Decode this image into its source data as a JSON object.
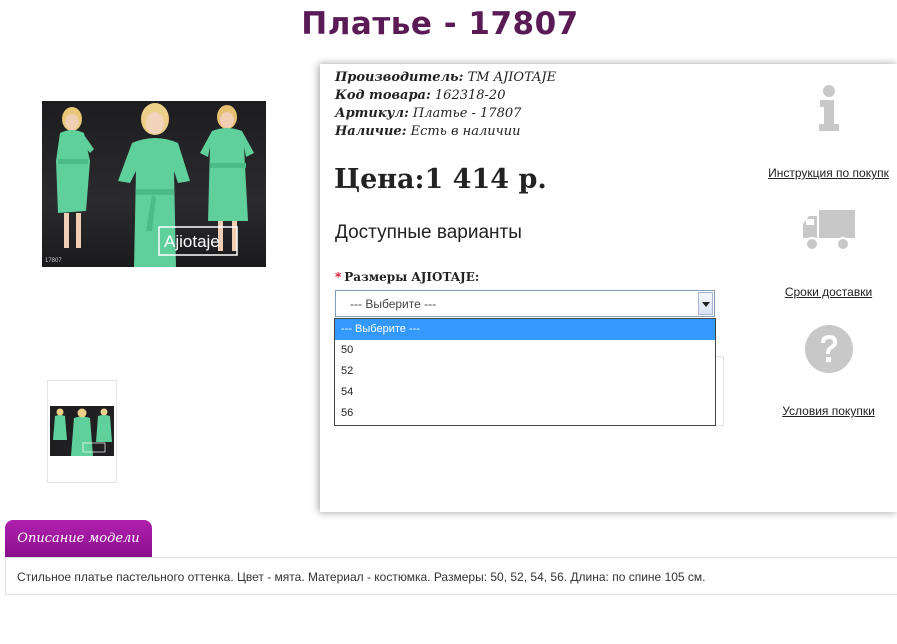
{
  "product": {
    "title": "Платье - 17807",
    "manufacturer_label": "Производитель:",
    "manufacturer_value": "ТМ AJIOTAJE",
    "code_label": "Код товара:",
    "code_value": "162318-20",
    "article_label": "Артикул:",
    "article_value": "Платье - 17807",
    "availability_label": "Наличие:",
    "availability_value": "Есть в наличии",
    "price": "Цена:1 414 р.",
    "photo_brand": "Ajiotaje",
    "photo_code": "17807"
  },
  "options": {
    "title": "Доступные варианты",
    "required_mark": "*",
    "size_label": "Размеры AJIOTAJE:",
    "selected": "--- Выберите ---",
    "items": [
      "--- Выберите ---",
      "50",
      "52",
      "54",
      "56"
    ]
  },
  "sidebar": {
    "instruction": "Инструкция по покупк",
    "delivery": "Сроки доставки",
    "conditions": "Условия покупки"
  },
  "tabs": {
    "description_label": "Описание модели"
  },
  "description": {
    "text": "Стильное платье пастельного оттенка. Цвет - мята. Материал - костюмка. Размеры: 50, 52, 54, 56. Длина: по спине 105 см."
  },
  "colors": {
    "title": "#5a1a55",
    "tab": "#9b169b",
    "dress": "#5fcf9c",
    "selected_option": "#3399ff",
    "icon_gray": "#c8c8c8"
  },
  "icons": [
    "info-icon",
    "truck-icon",
    "question-icon"
  ]
}
